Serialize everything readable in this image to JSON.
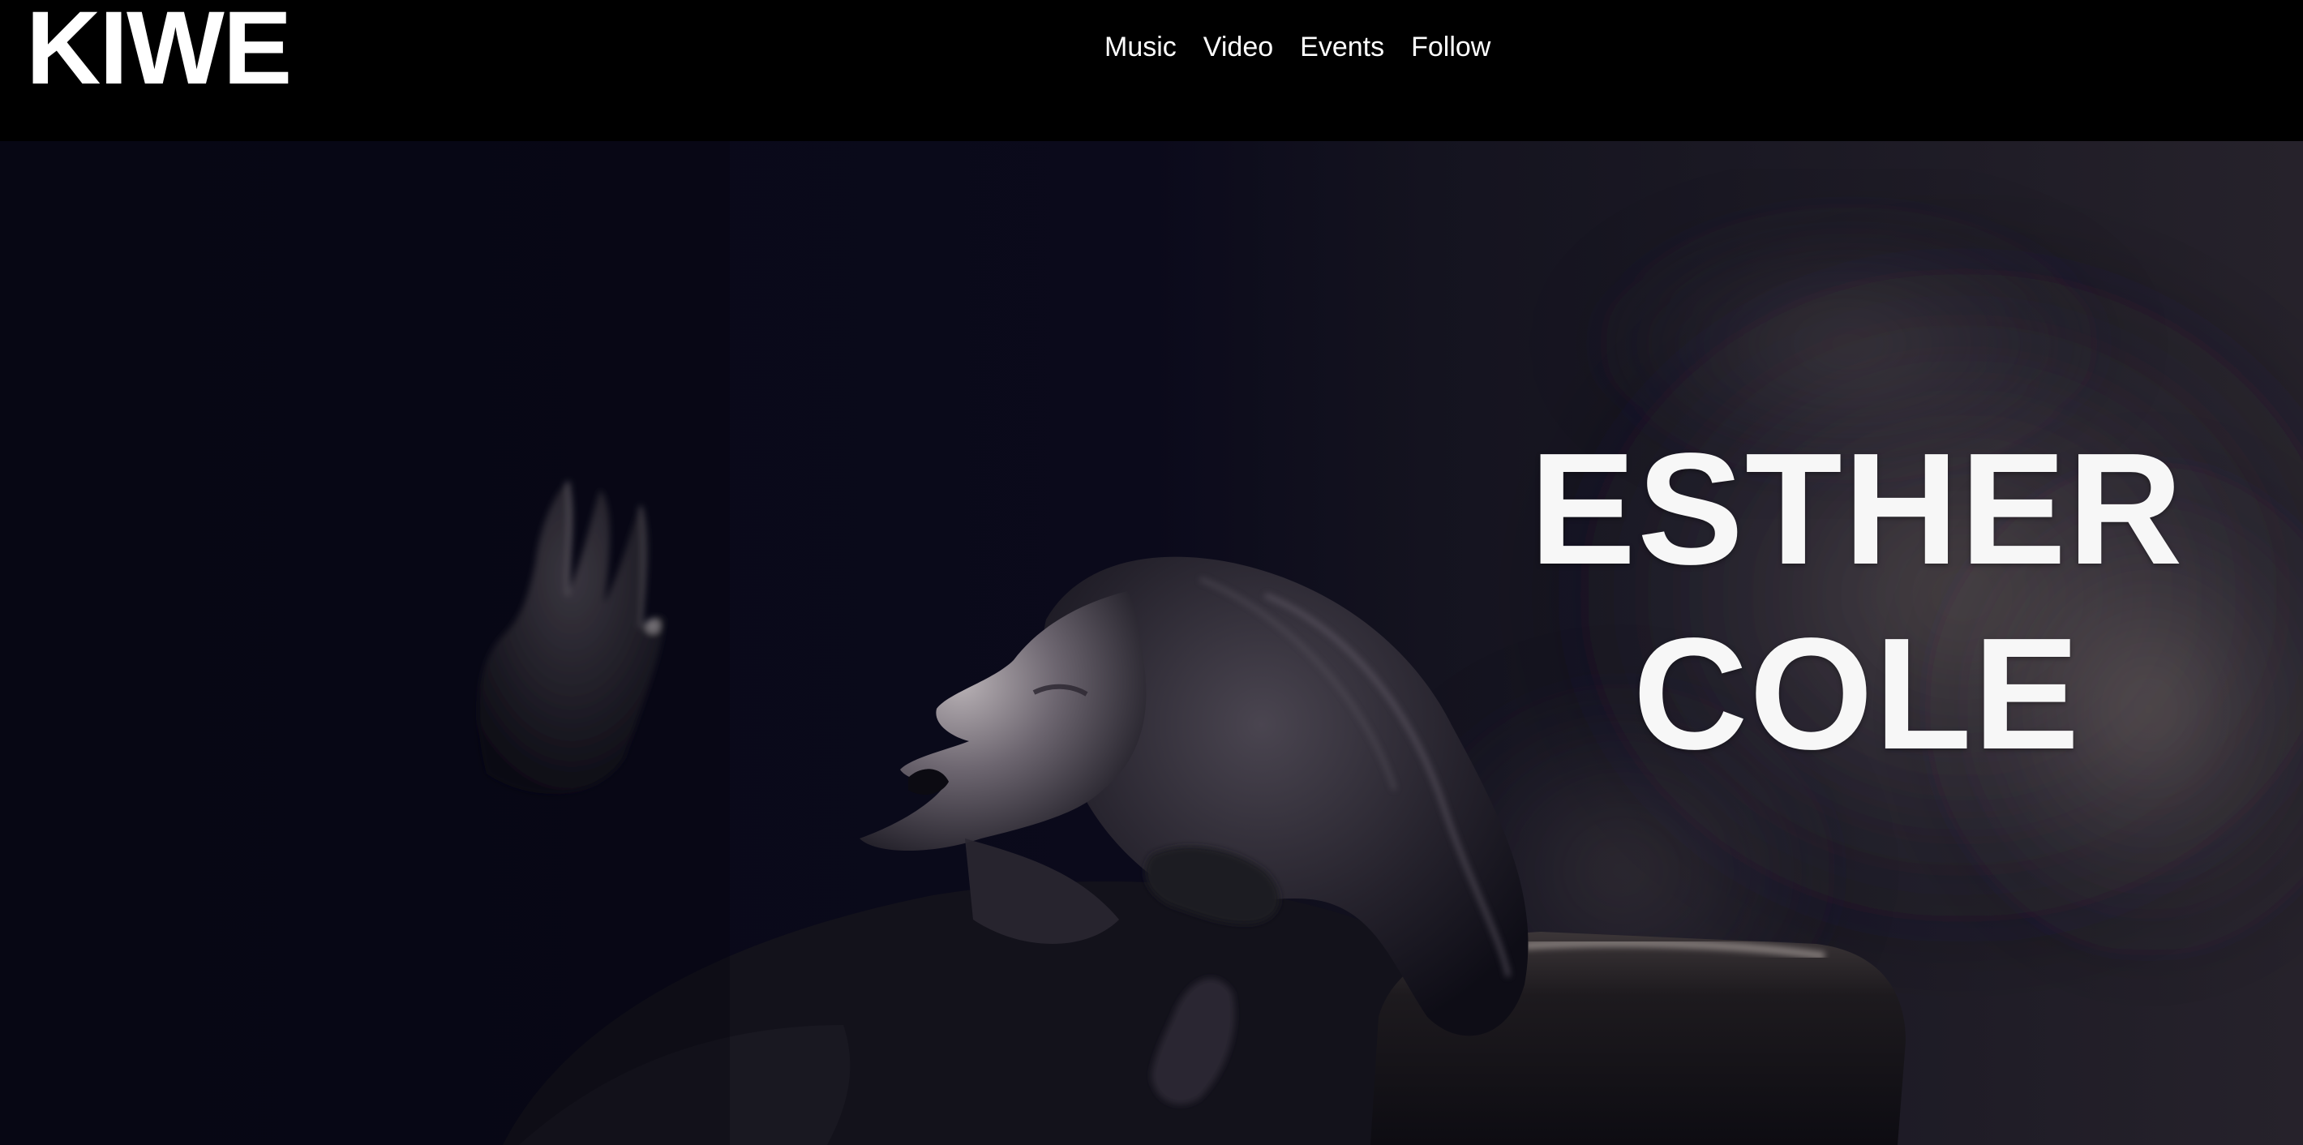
{
  "brand": {
    "logo_text": "KIWE"
  },
  "nav": {
    "items": [
      {
        "label": "Music"
      },
      {
        "label": "Video"
      },
      {
        "label": "Events"
      },
      {
        "label": "Follow"
      }
    ]
  },
  "hero": {
    "title_line_1": "ESTHER",
    "title_line_2": "COLE",
    "image_subject": "singer-performing-photo"
  },
  "colors": {
    "header_background": "#000000",
    "hero_background": "#0b0b19",
    "text": "#ffffff"
  }
}
